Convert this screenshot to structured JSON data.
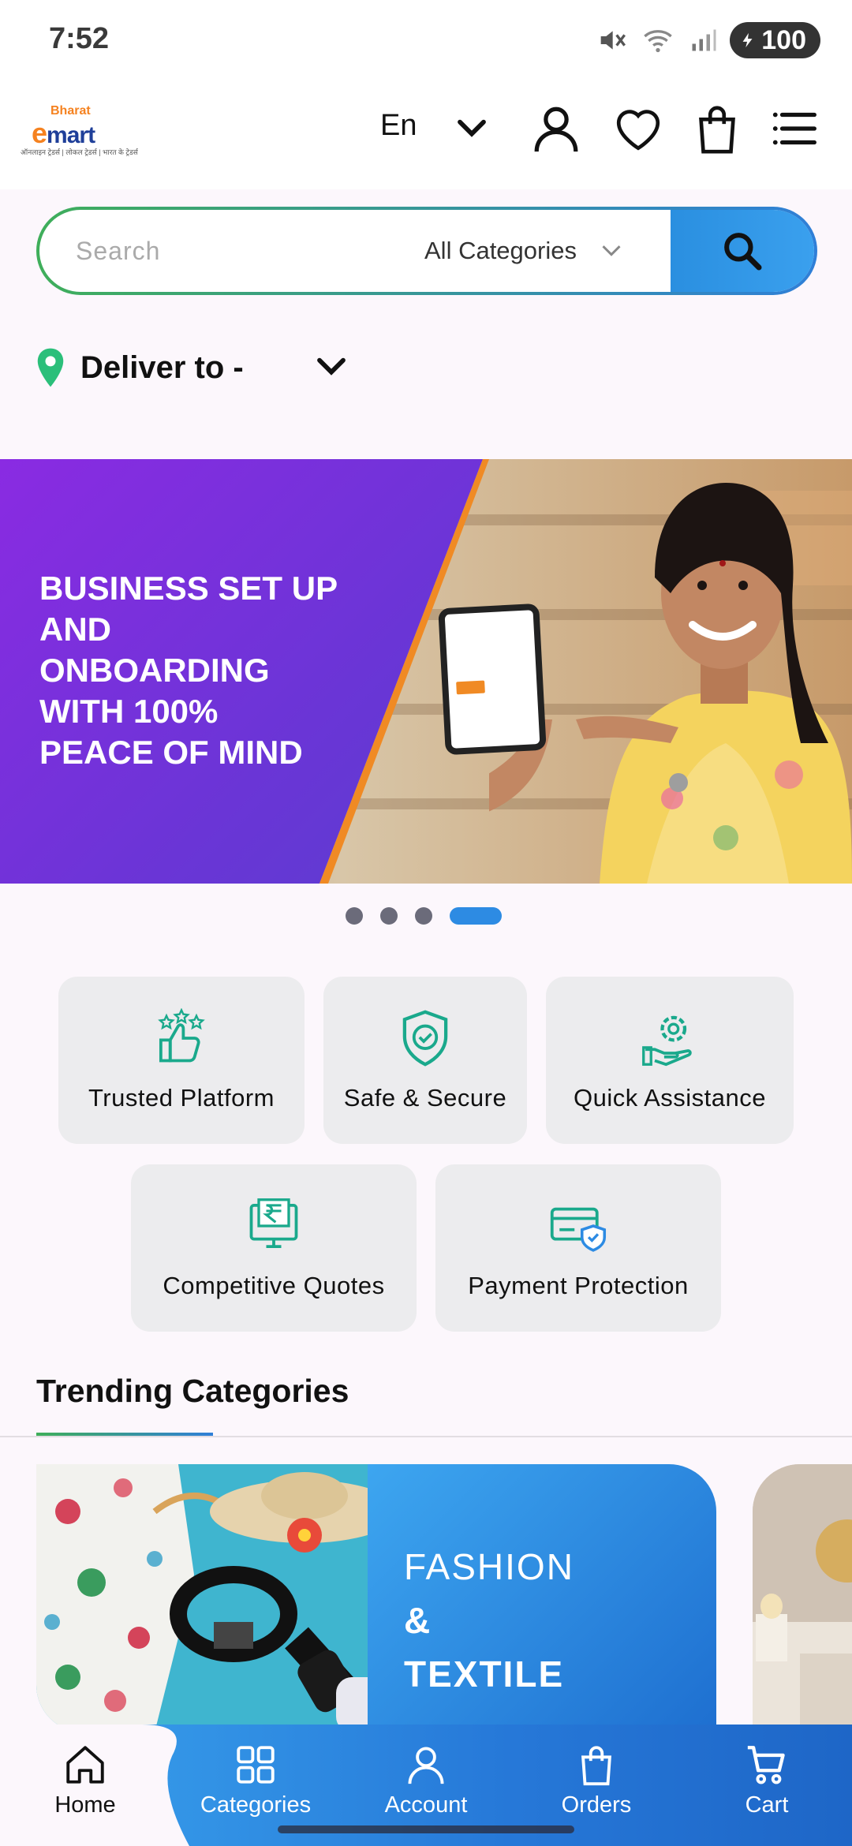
{
  "status_bar": {
    "time": "7:52",
    "battery": "100",
    "icons": [
      "mute-icon",
      "wifi-icon",
      "signal-icon",
      "battery-icon"
    ]
  },
  "header": {
    "logo": {
      "small": "Bharat",
      "main_e": "e",
      "main_rest": "mart",
      "tagline": "ऑनलाइन ट्रेडर्स | लोकल ट्रेडर्स | भारत के ट्रेडर्स"
    },
    "language": "En",
    "icons": [
      "user-icon",
      "heart-icon",
      "bag-icon",
      "menu-icon"
    ]
  },
  "search": {
    "placeholder": "Search",
    "category": "All Categories"
  },
  "delivery": {
    "label": "Deliver to  -"
  },
  "banner": {
    "text": "BUSINESS SET UP AND ONBOARDING WITH 100% PEACE OF MIND",
    "slides_total": 4,
    "active_slide": 4
  },
  "features": [
    {
      "label": "Trusted Platform",
      "icon": "thumbs-up-stars-icon"
    },
    {
      "label": "Safe & Secure",
      "icon": "shield-check-icon"
    },
    {
      "label": "Quick Assistance",
      "icon": "support-gear-icon"
    },
    {
      "label": "Competitive Quotes",
      "icon": "rupee-monitor-icon"
    },
    {
      "label": "Payment Protection",
      "icon": "card-shield-icon"
    }
  ],
  "trending": {
    "title": "Trending Categories",
    "cards": [
      {
        "line1": "FASHION",
        "line2": "&",
        "line3": "TEXTILE"
      }
    ]
  },
  "bottom_nav": [
    {
      "label": "Home",
      "icon": "home-icon"
    },
    {
      "label": "Categories",
      "icon": "grid-icon"
    },
    {
      "label": "Account",
      "icon": "user-icon"
    },
    {
      "label": "Orders",
      "icon": "bag-icon"
    },
    {
      "label": "Cart",
      "icon": "cart-icon"
    }
  ],
  "colors": {
    "accent_blue": "#2d8be3",
    "accent_green": "#3fae5a",
    "banner_purple": "#8a2be2",
    "banner_orange": "#f08a24",
    "background": "#fcf7fc"
  }
}
